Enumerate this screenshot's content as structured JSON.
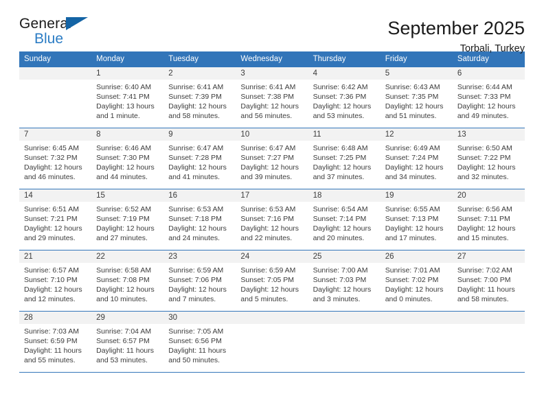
{
  "brand": {
    "name_part1": "General",
    "name_part2": "Blue",
    "accent_color": "#1464a5",
    "text_blue": "#2b7cc4"
  },
  "header": {
    "title": "September 2025",
    "subtitle": "Torbali, Turkey"
  },
  "theme": {
    "header_blue": "#3275b9",
    "daynum_band": "#f2f2f2",
    "body_text": "#3b3b3b"
  },
  "weekday_headers": [
    "Sunday",
    "Monday",
    "Tuesday",
    "Wednesday",
    "Thursday",
    "Friday",
    "Saturday"
  ],
  "weeks": [
    [
      {
        "day": "",
        "blank": true,
        "lines": []
      },
      {
        "day": "1",
        "lines": [
          "Sunrise: 6:40 AM",
          "Sunset: 7:41 PM",
          "Daylight: 13 hours",
          "and 1 minute."
        ]
      },
      {
        "day": "2",
        "lines": [
          "Sunrise: 6:41 AM",
          "Sunset: 7:39 PM",
          "Daylight: 12 hours",
          "and 58 minutes."
        ]
      },
      {
        "day": "3",
        "lines": [
          "Sunrise: 6:41 AM",
          "Sunset: 7:38 PM",
          "Daylight: 12 hours",
          "and 56 minutes."
        ]
      },
      {
        "day": "4",
        "lines": [
          "Sunrise: 6:42 AM",
          "Sunset: 7:36 PM",
          "Daylight: 12 hours",
          "and 53 minutes."
        ]
      },
      {
        "day": "5",
        "lines": [
          "Sunrise: 6:43 AM",
          "Sunset: 7:35 PM",
          "Daylight: 12 hours",
          "and 51 minutes."
        ]
      },
      {
        "day": "6",
        "lines": [
          "Sunrise: 6:44 AM",
          "Sunset: 7:33 PM",
          "Daylight: 12 hours",
          "and 49 minutes."
        ]
      }
    ],
    [
      {
        "day": "7",
        "lines": [
          "Sunrise: 6:45 AM",
          "Sunset: 7:32 PM",
          "Daylight: 12 hours",
          "and 46 minutes."
        ]
      },
      {
        "day": "8",
        "lines": [
          "Sunrise: 6:46 AM",
          "Sunset: 7:30 PM",
          "Daylight: 12 hours",
          "and 44 minutes."
        ]
      },
      {
        "day": "9",
        "lines": [
          "Sunrise: 6:47 AM",
          "Sunset: 7:28 PM",
          "Daylight: 12 hours",
          "and 41 minutes."
        ]
      },
      {
        "day": "10",
        "lines": [
          "Sunrise: 6:47 AM",
          "Sunset: 7:27 PM",
          "Daylight: 12 hours",
          "and 39 minutes."
        ]
      },
      {
        "day": "11",
        "lines": [
          "Sunrise: 6:48 AM",
          "Sunset: 7:25 PM",
          "Daylight: 12 hours",
          "and 37 minutes."
        ]
      },
      {
        "day": "12",
        "lines": [
          "Sunrise: 6:49 AM",
          "Sunset: 7:24 PM",
          "Daylight: 12 hours",
          "and 34 minutes."
        ]
      },
      {
        "day": "13",
        "lines": [
          "Sunrise: 6:50 AM",
          "Sunset: 7:22 PM",
          "Daylight: 12 hours",
          "and 32 minutes."
        ]
      }
    ],
    [
      {
        "day": "14",
        "lines": [
          "Sunrise: 6:51 AM",
          "Sunset: 7:21 PM",
          "Daylight: 12 hours",
          "and 29 minutes."
        ]
      },
      {
        "day": "15",
        "lines": [
          "Sunrise: 6:52 AM",
          "Sunset: 7:19 PM",
          "Daylight: 12 hours",
          "and 27 minutes."
        ]
      },
      {
        "day": "16",
        "lines": [
          "Sunrise: 6:53 AM",
          "Sunset: 7:18 PM",
          "Daylight: 12 hours",
          "and 24 minutes."
        ]
      },
      {
        "day": "17",
        "lines": [
          "Sunrise: 6:53 AM",
          "Sunset: 7:16 PM",
          "Daylight: 12 hours",
          "and 22 minutes."
        ]
      },
      {
        "day": "18",
        "lines": [
          "Sunrise: 6:54 AM",
          "Sunset: 7:14 PM",
          "Daylight: 12 hours",
          "and 20 minutes."
        ]
      },
      {
        "day": "19",
        "lines": [
          "Sunrise: 6:55 AM",
          "Sunset: 7:13 PM",
          "Daylight: 12 hours",
          "and 17 minutes."
        ]
      },
      {
        "day": "20",
        "lines": [
          "Sunrise: 6:56 AM",
          "Sunset: 7:11 PM",
          "Daylight: 12 hours",
          "and 15 minutes."
        ]
      }
    ],
    [
      {
        "day": "21",
        "lines": [
          "Sunrise: 6:57 AM",
          "Sunset: 7:10 PM",
          "Daylight: 12 hours",
          "and 12 minutes."
        ]
      },
      {
        "day": "22",
        "lines": [
          "Sunrise: 6:58 AM",
          "Sunset: 7:08 PM",
          "Daylight: 12 hours",
          "and 10 minutes."
        ]
      },
      {
        "day": "23",
        "lines": [
          "Sunrise: 6:59 AM",
          "Sunset: 7:06 PM",
          "Daylight: 12 hours",
          "and 7 minutes."
        ]
      },
      {
        "day": "24",
        "lines": [
          "Sunrise: 6:59 AM",
          "Sunset: 7:05 PM",
          "Daylight: 12 hours",
          "and 5 minutes."
        ]
      },
      {
        "day": "25",
        "lines": [
          "Sunrise: 7:00 AM",
          "Sunset: 7:03 PM",
          "Daylight: 12 hours",
          "and 3 minutes."
        ]
      },
      {
        "day": "26",
        "lines": [
          "Sunrise: 7:01 AM",
          "Sunset: 7:02 PM",
          "Daylight: 12 hours",
          "and 0 minutes."
        ]
      },
      {
        "day": "27",
        "lines": [
          "Sunrise: 7:02 AM",
          "Sunset: 7:00 PM",
          "Daylight: 11 hours",
          "and 58 minutes."
        ]
      }
    ],
    [
      {
        "day": "28",
        "lines": [
          "Sunrise: 7:03 AM",
          "Sunset: 6:59 PM",
          "Daylight: 11 hours",
          "and 55 minutes."
        ]
      },
      {
        "day": "29",
        "lines": [
          "Sunrise: 7:04 AM",
          "Sunset: 6:57 PM",
          "Daylight: 11 hours",
          "and 53 minutes."
        ]
      },
      {
        "day": "30",
        "lines": [
          "Sunrise: 7:05 AM",
          "Sunset: 6:56 PM",
          "Daylight: 11 hours",
          "and 50 minutes."
        ]
      },
      {
        "day": "",
        "blank": true,
        "lines": []
      },
      {
        "day": "",
        "blank": true,
        "lines": []
      },
      {
        "day": "",
        "blank": true,
        "lines": []
      },
      {
        "day": "",
        "blank": true,
        "lines": []
      }
    ]
  ]
}
